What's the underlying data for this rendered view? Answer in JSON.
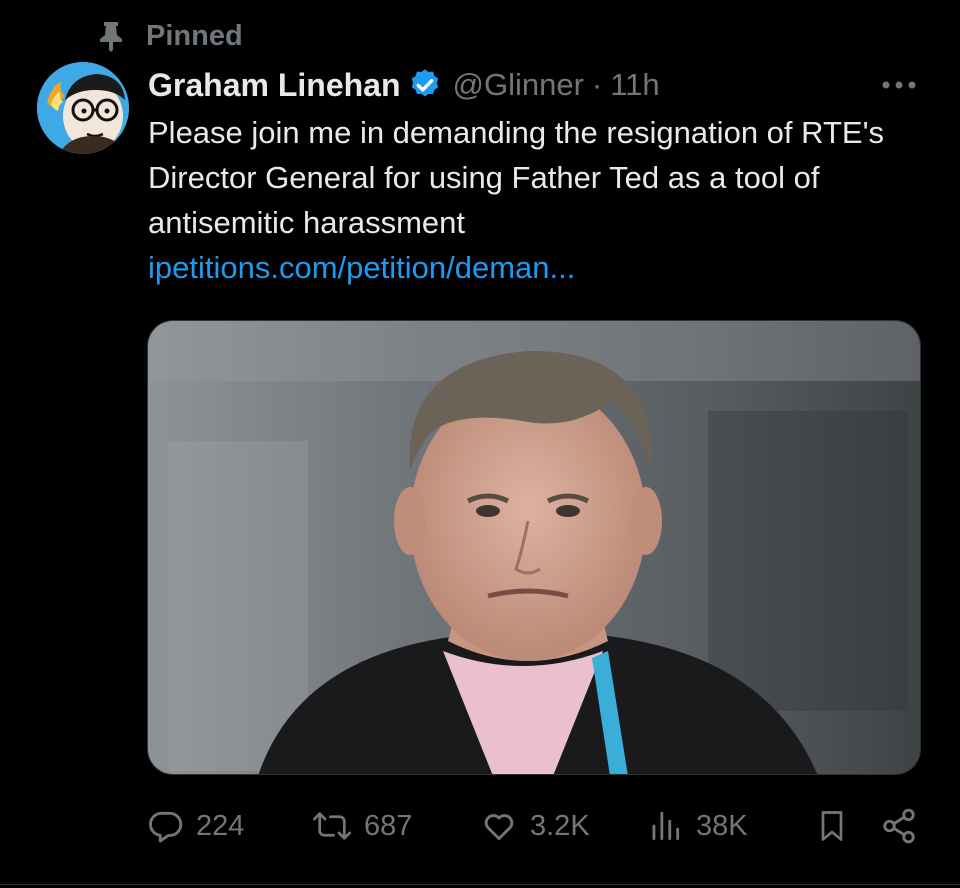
{
  "pinned": {
    "label": "Pinned"
  },
  "author": {
    "display_name": "Graham Linehan",
    "handle": "@Glinner",
    "separator": "·",
    "time": "11h",
    "verified": true
  },
  "tweet": {
    "text": "Please join me in demanding the resignation of RTE's Director General for using Father Ted as a tool of antisemitic harassment",
    "link": "ipetitions.com/petition/deman..."
  },
  "media": {
    "description_icon": "photo",
    "colors": {
      "background": "#6f7478",
      "hair": "#6b6258",
      "skin": "#d2a48f",
      "jacket": "#1a1a1c",
      "shirt": "#e9c0cc",
      "lanyard": "#3aaed8"
    }
  },
  "actions": {
    "reply_count": "224",
    "retweet_count": "687",
    "like_count": "3.2K",
    "view_count": "38K"
  },
  "icons": {
    "pin": "pin-icon",
    "verified": "verified-badge-icon",
    "more": "more-dots-icon",
    "reply": "reply-icon",
    "retweet": "retweet-icon",
    "like": "heart-icon",
    "views": "views-bar-chart-icon",
    "bookmark": "bookmark-icon",
    "share": "share-icon"
  },
  "theme": {
    "background": "#000000",
    "text_primary": "#e7e9ea",
    "text_secondary": "#71767b",
    "link": "#1d9bf0",
    "verified": "#1d9bf0",
    "border": "#2f3336"
  }
}
